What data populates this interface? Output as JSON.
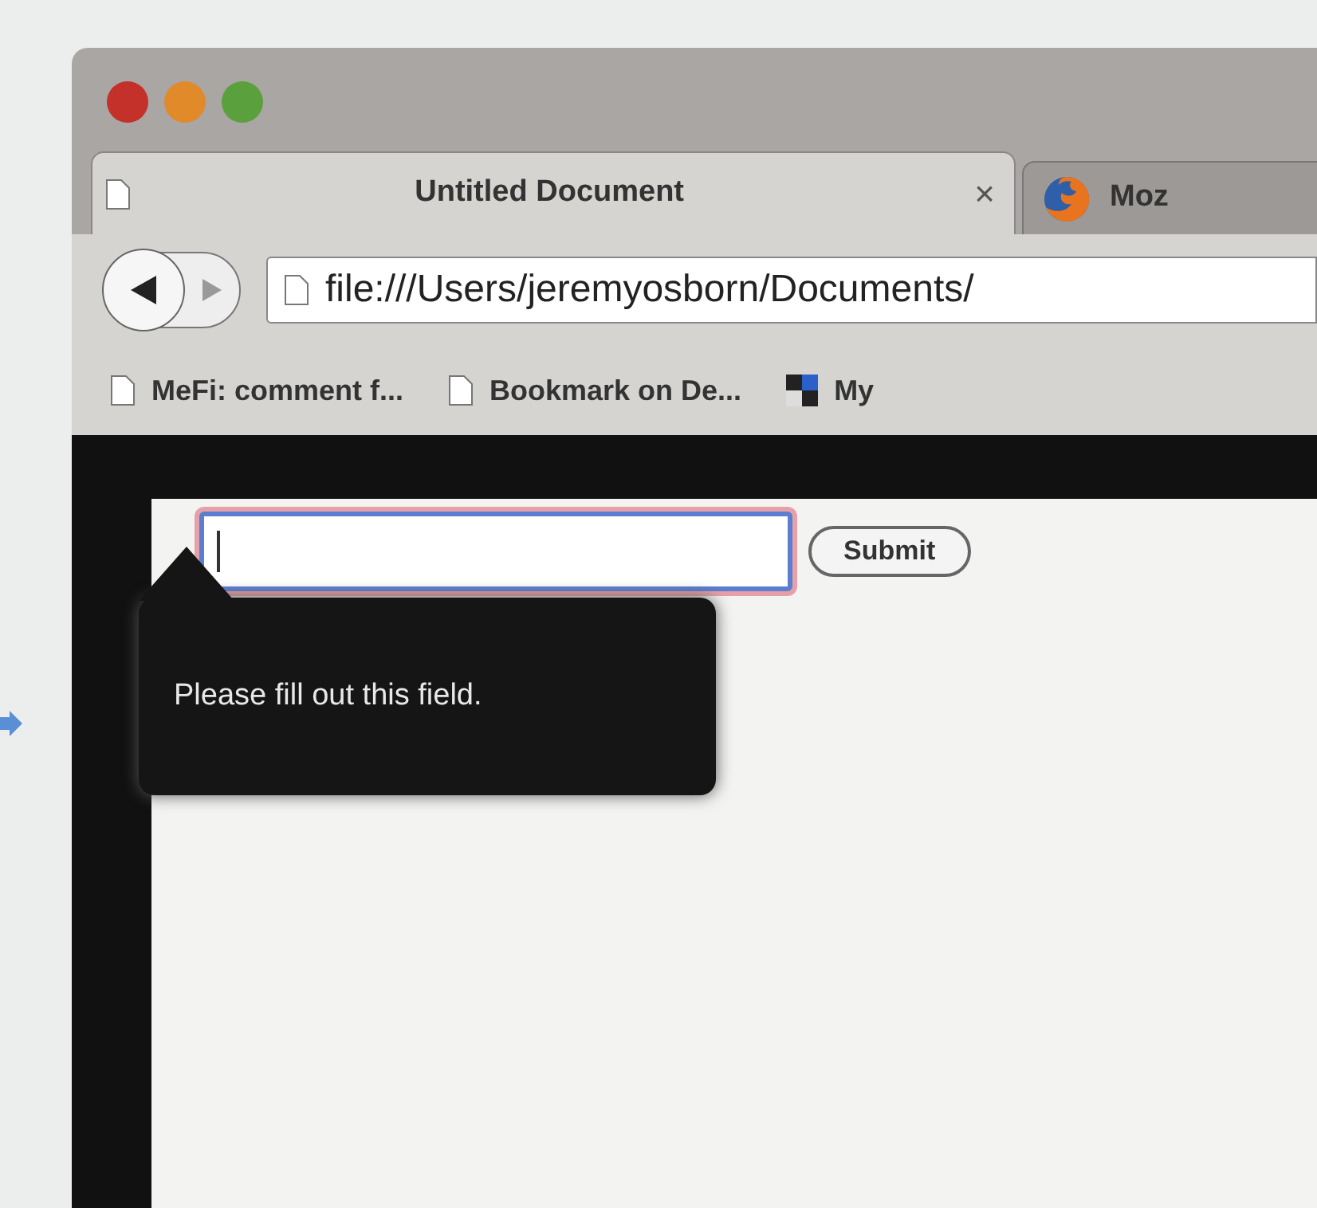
{
  "tabs": [
    {
      "title": "Untitled Document",
      "close": "×",
      "selected": true
    },
    {
      "title": "Moz",
      "selected": false
    }
  ],
  "toolbar": {
    "address": "file:///Users/jeremyosborn/Documents/"
  },
  "bookmarks": [
    {
      "label": "MeFi: comment f...",
      "kind": "page"
    },
    {
      "label": "Bookmark on De...",
      "kind": "page"
    },
    {
      "label": "My",
      "kind": "site"
    }
  ],
  "form": {
    "field": {
      "invalid": true
    },
    "submit": "Submit"
  },
  "tooltip": {
    "text": "Please fill out this field."
  }
}
